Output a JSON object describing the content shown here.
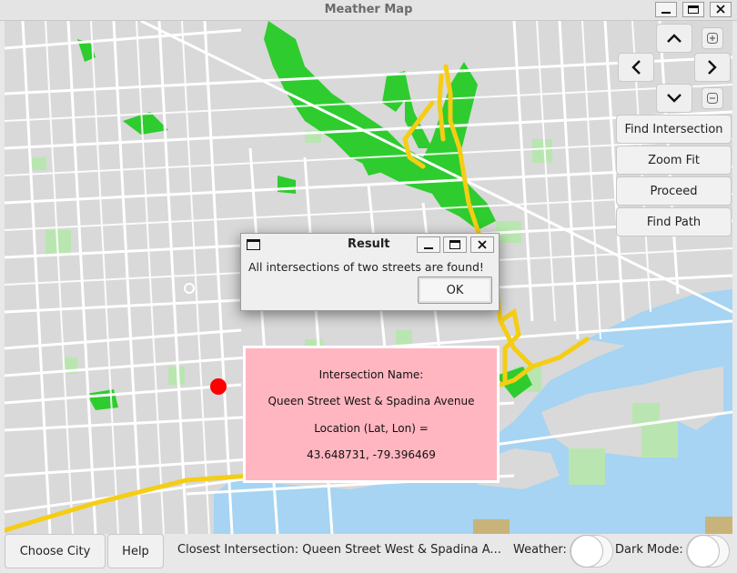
{
  "window": {
    "title": "Meather Map"
  },
  "controls": {
    "action_buttons": [
      "Find Intersection",
      "Zoom Fit",
      "Proceed",
      "Find Path"
    ]
  },
  "dialog": {
    "title": "Result",
    "message": "All intersections of two streets are found!",
    "ok_label": "OK"
  },
  "info_box": {
    "name_label": "Intersection Name:",
    "name_value": "Queen Street West & Spadina Avenue",
    "location_label": "Location (Lat, Lon) =",
    "location_value": "43.648731, -79.396469"
  },
  "bottom_bar": {
    "choose_city": "Choose City",
    "help": "Help",
    "closest": "Closest Intersection: Queen Street West & Spadina A...",
    "weather_label": "Weather:",
    "dark_mode_label": "Dark Mode:"
  },
  "colors": {
    "map_background": "#d9d9d9",
    "street": "#ffffff",
    "park": "#b9e6b0",
    "forest": "#2ecc2e",
    "highway": "#f5cd14",
    "water": "#a6d4f2",
    "info_background": "#ffb6c1",
    "marker": "#ff0000"
  }
}
